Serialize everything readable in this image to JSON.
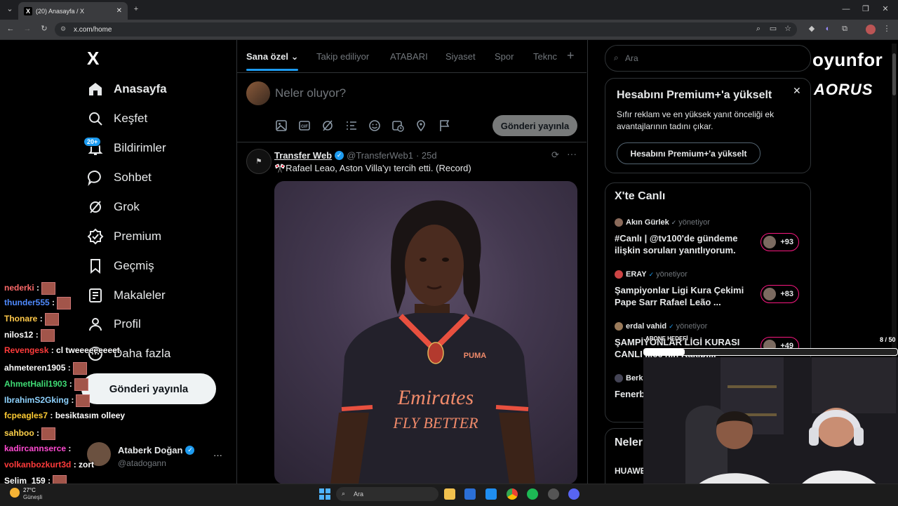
{
  "browser": {
    "tab_title": "(20) Anasayfa / X",
    "url": "x.com/home"
  },
  "sidebar": {
    "logo": "X",
    "items": [
      {
        "label": "Anasayfa",
        "icon": "home-icon"
      },
      {
        "label": "Keşfet",
        "icon": "search-icon"
      },
      {
        "label": "Bildirimler",
        "icon": "bell-icon",
        "badge": "20+"
      },
      {
        "label": "Sohbet",
        "icon": "chat-icon"
      },
      {
        "label": "Grok",
        "icon": "grok-icon"
      },
      {
        "label": "Premium",
        "icon": "premium-icon"
      },
      {
        "label": "Geçmiş",
        "icon": "bookmark-icon"
      },
      {
        "label": "Makaleler",
        "icon": "article-icon"
      },
      {
        "label": "Profil",
        "icon": "person-icon"
      },
      {
        "label": "Daha fazla",
        "icon": "more-circle-icon"
      }
    ],
    "post_button": "Gönderi yayınla",
    "account": {
      "name": "Ataberk Doğan",
      "handle": "@atadogann",
      "more": "···"
    }
  },
  "feed": {
    "tabs": [
      "Sana özel",
      "Takip ediliyor",
      "ATABARI",
      "Siyaset",
      "Spor",
      "Teknc"
    ],
    "composer_placeholder": "Neler oluyor?",
    "compose_button": "Gönderi yayınla",
    "tweet": {
      "author": "Transfer Web",
      "handle": "@TransferWeb1",
      "age": "· 25d",
      "text": "🎌Rafael Leao, Aston Villa'yı tercih etti. (Record)",
      "image_text": {
        "sponsor": "Emirates",
        "slogan": "FLY BETTER",
        "kit_brand": "PUMA"
      }
    }
  },
  "right": {
    "search_placeholder": "Ara",
    "premium": {
      "title": "Hesabını Premium+'a yükselt",
      "body": "Sıfır reklam ve en yüksek yanıt önceliği ek avantajlarının tadını çıkar.",
      "button": "Hesabını Premium+'a yükselt"
    },
    "live": {
      "title": "X'te Canlı",
      "items": [
        {
          "host": "Akın Gürlek",
          "role": "yönetiyor",
          "title": "#Canlı | @tv100'de gündeme ilişkin soruları yanıtlıyorum.",
          "count": "+93"
        },
        {
          "host": "ERAY",
          "role": "yönetiyor",
          "title": "Şampiyonlar Ligi Kura Çekimi Pape Sarr Rafael Leão ...",
          "count": "+83"
        },
        {
          "host": "erdal vahid",
          "role": "yönetiyor",
          "title": "ŞAMPİYONLAR LİGİ KURASI CANLI ...ce'nin Rakipl...",
          "count": "+49"
        },
        {
          "host": "Berk",
          "role": "",
          "title": "Fenerb... Kojo Op...",
          "count": ""
        }
      ]
    },
    "next_title": "Neler",
    "next_item": "HUAWE"
  },
  "overlay": {
    "brand1": "oyunfor",
    "brand2": "AORUS",
    "progress_label": "ABONE HEDEFİ",
    "progress_count": "8 / 50",
    "progress_fraction": 0.16
  },
  "chat": [
    {
      "user": "nederki",
      "msg": ":",
      "color": "#ff6a6a",
      "emote": true
    },
    {
      "user": "thunder555",
      "msg": ":",
      "color": "#4f8bff",
      "emote": true
    },
    {
      "user": "Thonare",
      "msg": ":",
      "color": "#ffc94a",
      "emote": true
    },
    {
      "user": "nilos12",
      "msg": ":",
      "color": "#ffffff",
      "emote": true
    },
    {
      "user": "Revengesk",
      "msg": ": cl tweeeeeeeeet",
      "color": "#ff3b3b",
      "emote": false
    },
    {
      "user": "ahmeteren1905",
      "msg": ":",
      "color": "#ffffff",
      "emote": true
    },
    {
      "user": "AhmetHalil1903",
      "msg": ":",
      "color": "#3fdc75",
      "emote": true
    },
    {
      "user": "IbrahimS2Gking",
      "msg": ":",
      "color": "#8fd3ff",
      "emote": true
    },
    {
      "user": "fcpeagles7",
      "msg": ": besiktasım olleey",
      "color": "#ffcc33",
      "emote": false
    },
    {
      "user": "sahboo",
      "msg": ":",
      "color": "#ffd24a",
      "emote": true
    },
    {
      "user": "kadircannserce",
      "msg": ":",
      "color": "#ff4ad2",
      "emote": false
    },
    {
      "user": "volkanbozkurt3d",
      "msg": ": zort",
      "color": "#ff3b3b",
      "emote": false
    },
    {
      "user": "Selim_159",
      "msg": ":",
      "color": "#ffffff",
      "emote": true
    }
  ],
  "taskbar": {
    "weather_temp": "27°C",
    "weather_desc": "Güneşli",
    "search": "Ara"
  }
}
